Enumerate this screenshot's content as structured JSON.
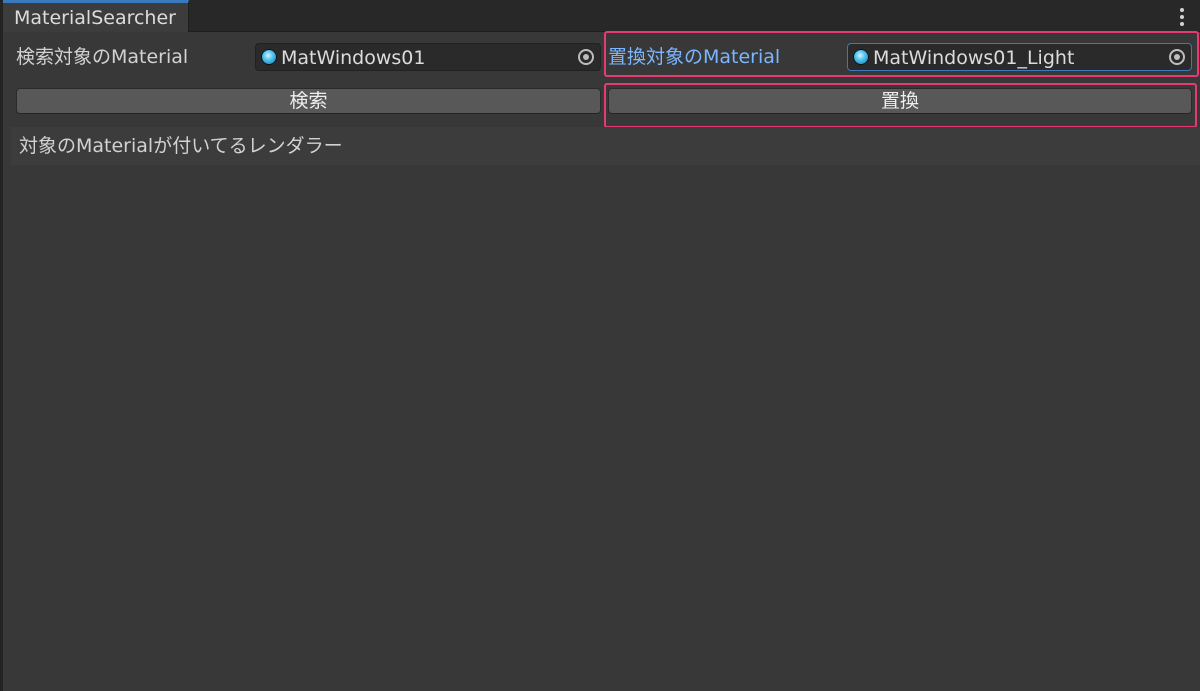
{
  "window": {
    "tab_title": "MaterialSearcher"
  },
  "search_field": {
    "label": "検索対象のMaterial",
    "value": "MatWindows01"
  },
  "replace_field": {
    "label": "置換対象のMaterial",
    "value": "MatWindows01_Light"
  },
  "buttons": {
    "search_label": "検索",
    "replace_label": "置換"
  },
  "results": {
    "header": "対象のMaterialが付いてるレンダラー"
  },
  "colors": {
    "highlight": "#e63a72",
    "active_label": "#7bb6ff",
    "focus_border": "#3a79bb",
    "tab_accent": "#3a79bb"
  }
}
